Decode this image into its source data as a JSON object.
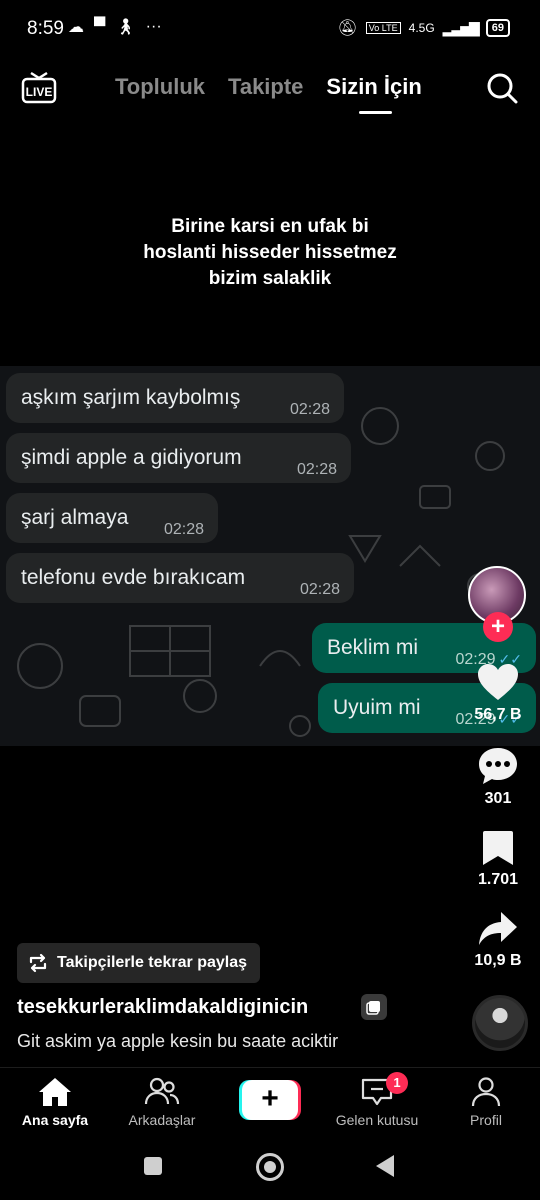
{
  "status_bar": {
    "time": "8:59",
    "network": "4.5G",
    "battery": "69"
  },
  "top_nav": {
    "live_label": "LIVE",
    "tabs": [
      {
        "label": "Topluluk",
        "active": false
      },
      {
        "label": "Takipte",
        "active": false
      },
      {
        "label": "Sizin İçin",
        "active": true
      }
    ]
  },
  "video": {
    "caption_lines": [
      "Birine karsi en ufak bi",
      "hoslanti hisseder hissetmez",
      "bizim salaklik"
    ],
    "chat": {
      "incoming": [
        {
          "text": "aşkım şarjım kaybolmış",
          "time": "02:28"
        },
        {
          "text": "şimdi apple a gidiyorum",
          "time": "02:28"
        },
        {
          "text": "şarj almaya",
          "time": "02:28"
        },
        {
          "text": "telefonu evde bırakıcam",
          "time": "02:28"
        }
      ],
      "outgoing": [
        {
          "text": "Beklim mi",
          "time": "02:29"
        },
        {
          "text": "Uyuim mi",
          "time": "02:29"
        }
      ],
      "read_ticks": "✓✓"
    }
  },
  "rail": {
    "likes": "56,7 B",
    "comments": "301",
    "saves": "1.701",
    "shares": "10,9 B"
  },
  "post": {
    "repost_label": "Takipçilerle tekrar paylaş",
    "username": "tesekkurleraklimdakaldiginicin",
    "description": "Git askim ya apple kesin bu saate aciktir"
  },
  "bottom_nav": {
    "home": "Ana sayfa",
    "friends": "Arkadaşlar",
    "create": "+",
    "inbox": "Gelen kutusu",
    "inbox_badge": "1",
    "profile": "Profil"
  },
  "colors": {
    "accent": "#fe2c55",
    "cyan": "#25f4ee",
    "outgoing_bubble": "#005c4b",
    "incoming_bubble": "#232526"
  }
}
